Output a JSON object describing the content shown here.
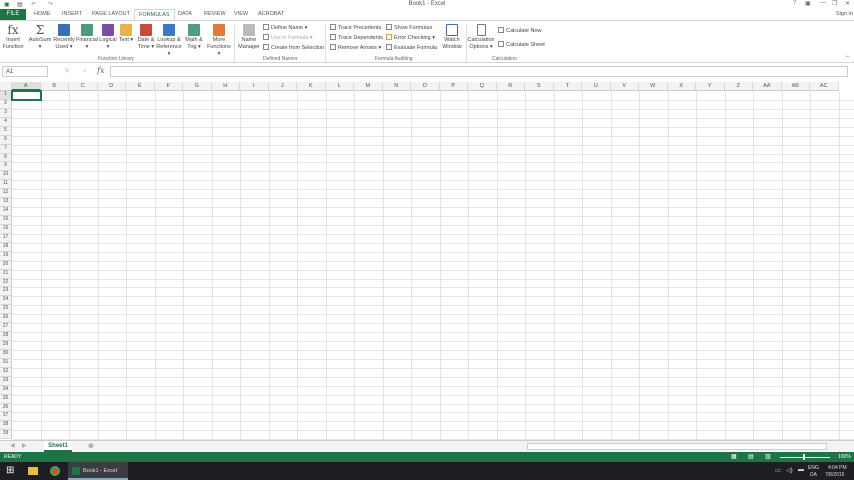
{
  "window": {
    "title": "Book1 - Excel",
    "signin": "Sign in",
    "controls": [
      "?",
      "▣",
      "—",
      "❐",
      "✕"
    ]
  },
  "tabs": {
    "file": "FILE",
    "items": [
      "HOME",
      "INSERT",
      "PAGE LAYOUT",
      "FORMULAS",
      "DATA",
      "REVIEW",
      "VIEW",
      "ACROBAT"
    ],
    "active": "FORMULAS"
  },
  "ribbon": {
    "function_library": {
      "label": "Function Library",
      "buttons": [
        {
          "label": "Insert Function",
          "icon": "fx-icon",
          "color": "#555555"
        },
        {
          "label": "AutoSum ▾",
          "icon": "sigma-icon",
          "color": "#555555"
        },
        {
          "label": "Recently Used ▾",
          "icon": "star-icon",
          "color": "#3a6db5"
        },
        {
          "label": "Financial ▾",
          "icon": "financial-icon",
          "color": "#4f9a7a"
        },
        {
          "label": "Logical ▾",
          "icon": "question-icon",
          "color": "#7a4ea8"
        },
        {
          "label": "Text ▾",
          "icon": "text-icon",
          "color": "#e8b34a"
        },
        {
          "label": "Date & Time ▾",
          "icon": "calendar-icon",
          "color": "#c84a3a"
        },
        {
          "label": "Lookup & Reference ▾",
          "icon": "lookup-icon",
          "color": "#3a7bc8"
        },
        {
          "label": "Math & Trig ▾",
          "icon": "math-icon",
          "color": "#4fa07a"
        },
        {
          "label": "More Functions ▾",
          "icon": "more-icon",
          "color": "#e07a3a"
        }
      ]
    },
    "defined_names": {
      "label": "Defined Names",
      "manager": "Name Manager",
      "items": [
        "Define Name ▾",
        "Use in Formula ▾",
        "Create from Selection"
      ]
    },
    "formula_auditing": {
      "label": "Formula Auditing",
      "items": [
        "Trace Precedents",
        "Trace Dependents",
        "Remove Arrows ▾",
        "Show Formulas",
        "Error Checking ▾",
        "Evaluate Formula"
      ],
      "watch": "Watch Window"
    },
    "calculation": {
      "label": "Calculation",
      "options": "Calculation Options ▾",
      "items": [
        "Calculate Now",
        "Calculate Sheet"
      ]
    }
  },
  "formula_bar": {
    "name_box": "A1",
    "value": ""
  },
  "grid": {
    "columns": [
      "A",
      "B",
      "C",
      "D",
      "E",
      "F",
      "G",
      "H",
      "I",
      "J",
      "K",
      "L",
      "M",
      "N",
      "O",
      "P",
      "Q",
      "R",
      "S",
      "T",
      "U",
      "V",
      "W",
      "X",
      "Y",
      "Z",
      "AA",
      "AB",
      "AC"
    ],
    "row_count": 39,
    "selected": "A1"
  },
  "sheets": {
    "tabs": [
      "Sheet1"
    ],
    "add": "⊕"
  },
  "status": {
    "text": "READY",
    "zoom": "100%"
  },
  "taskbar": {
    "app": "Book1 - Excel",
    "lang": "ENG",
    "region": "DA",
    "time": "4:04 PM",
    "date": "7/8/2015"
  }
}
